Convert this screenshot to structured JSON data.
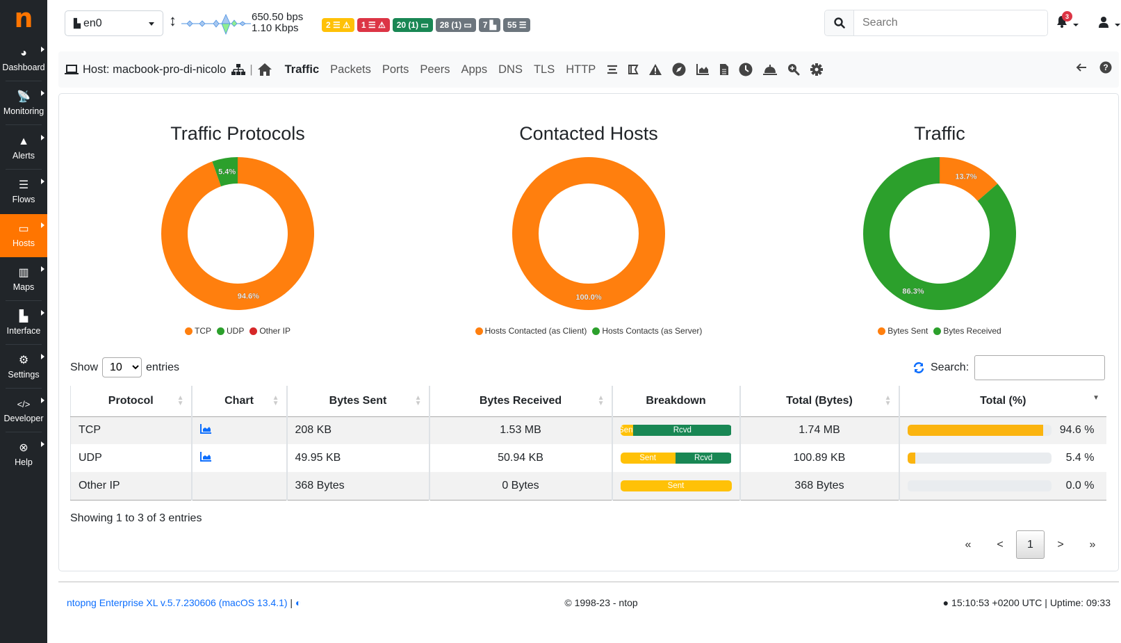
{
  "sidebar": {
    "logo": "n",
    "items": [
      {
        "label": "Dashboard",
        "icon": "gauge-icon",
        "glyph": "◕"
      },
      {
        "label": "Monitoring",
        "icon": "satellite-dish-icon",
        "glyph": "📡"
      },
      {
        "label": "Alerts",
        "icon": "warning-icon",
        "glyph": "▲"
      },
      {
        "label": "Flows",
        "icon": "stream-icon",
        "glyph": "☰"
      },
      {
        "label": "Hosts",
        "icon": "laptop-icon",
        "glyph": "▭",
        "active": true
      },
      {
        "label": "Maps",
        "icon": "map-icon",
        "glyph": "▥"
      },
      {
        "label": "Interface",
        "icon": "ethernet-icon",
        "glyph": "▙"
      },
      {
        "label": "Settings",
        "icon": "gear-icon",
        "glyph": "⚙"
      },
      {
        "label": "Developer",
        "icon": "code-icon",
        "glyph": "</>"
      },
      {
        "label": "Help",
        "icon": "life-ring-icon",
        "glyph": "⊗"
      }
    ]
  },
  "topbar": {
    "interface": "en0",
    "rate_up": "650.50 bps",
    "rate_down": "1.10 Kbps",
    "badges": [
      {
        "text": "2 ☰ ⚠",
        "color": "#ffc107",
        "name": "warning-alerts-badge"
      },
      {
        "text": "1 ☰ ⚠",
        "color": "#dc3545",
        "name": "error-alerts-badge"
      },
      {
        "text": "20 (1) ▭",
        "color": "#198754",
        "name": "local-hosts-badge"
      },
      {
        "text": "28 (1) ▭",
        "color": "#6c757d",
        "name": "remote-hosts-badge"
      },
      {
        "text": "7 ▙",
        "color": "#6c757d",
        "name": "devices-badge"
      },
      {
        "text": "55 ☰",
        "color": "#6c757d",
        "name": "flows-badge"
      }
    ],
    "search_placeholder": "Search",
    "notifications_count": "3"
  },
  "hostbar": {
    "title": "Host: macbook-pro-di-nicolo",
    "separator": "|",
    "tabs": [
      "Traffic",
      "Packets",
      "Ports",
      "Peers",
      "Apps",
      "DNS",
      "TLS",
      "HTTP"
    ],
    "active_tab": "Traffic"
  },
  "charts": {
    "protocols": {
      "title": "Traffic Protocols",
      "legend": [
        "TCP",
        "UDP",
        "Other IP"
      ]
    },
    "contacted": {
      "title": "Contacted Hosts",
      "legend": [
        "Hosts Contacted (as Client)",
        "Hosts Contacts (as Server)"
      ]
    },
    "traffic": {
      "title": "Traffic",
      "legend": [
        "Bytes Sent",
        "Bytes Received"
      ]
    }
  },
  "chart_data": [
    {
      "type": "pie",
      "title": "Traffic Protocols",
      "categories": [
        "TCP",
        "UDP",
        "Other IP"
      ],
      "values": [
        94.6,
        5.4,
        0.0
      ],
      "labels": [
        "94.6%",
        "5.4%",
        ""
      ],
      "colors": [
        "#ff7f0e",
        "#2ca02c",
        "#d62728"
      ],
      "legend": "bottom"
    },
    {
      "type": "pie",
      "title": "Contacted Hosts",
      "categories": [
        "Hosts Contacted (as Client)",
        "Hosts Contacts (as Server)"
      ],
      "values": [
        100.0,
        0.0
      ],
      "labels": [
        "100.0%",
        ""
      ],
      "colors": [
        "#ff7f0e",
        "#2ca02c"
      ],
      "legend": "bottom"
    },
    {
      "type": "pie",
      "title": "Traffic",
      "categories": [
        "Bytes Sent",
        "Bytes Received"
      ],
      "values": [
        13.7,
        86.3
      ],
      "labels": [
        "13.7%",
        "86.3%"
      ],
      "colors": [
        "#ff7f0e",
        "#2ca02c"
      ],
      "legend": "bottom"
    }
  ],
  "table": {
    "show_label": "Show",
    "entries_label": "entries",
    "page_size": "10",
    "search_label": "Search:",
    "columns": [
      "Protocol",
      "Chart",
      "Bytes Sent",
      "Bytes Received",
      "Breakdown",
      "Total (Bytes)",
      "Total (%)"
    ],
    "rows": [
      {
        "protocol": "TCP",
        "chart": true,
        "sent": "208 KB",
        "received": "1.53 MB",
        "sent_pct": 11.7,
        "sent_label": "Sent",
        "rcvd_label": "Rcvd",
        "total": "1.74 MB",
        "pct": 94.6,
        "pct_label": "94.6 %"
      },
      {
        "protocol": "UDP",
        "chart": true,
        "sent": "49.95 KB",
        "received": "50.94 KB",
        "sent_pct": 49.5,
        "sent_label": "Sent",
        "rcvd_label": "Rcvd",
        "total": "100.89 KB",
        "pct": 5.4,
        "pct_label": "5.4 %"
      },
      {
        "protocol": "Other IP",
        "chart": false,
        "sent": "368 Bytes",
        "received": "0 Bytes",
        "sent_pct": 100,
        "sent_label": "Sent",
        "rcvd_label": "",
        "total": "368 Bytes",
        "pct": 0.0,
        "pct_label": "0.0 %"
      }
    ],
    "info": "Showing 1 to 3 of 3 entries",
    "pager": {
      "first": "«",
      "prev": "<",
      "current": "1",
      "next": ">",
      "last": "»"
    }
  },
  "footer": {
    "version": "ntopng Enterprise XL v.5.7.230606 (macOS 13.4.1)",
    "sep": "|",
    "copyright": "© 1998-23 - ntop",
    "clock": "15:10:53 +0200 UTC | Uptime: 09:33"
  }
}
